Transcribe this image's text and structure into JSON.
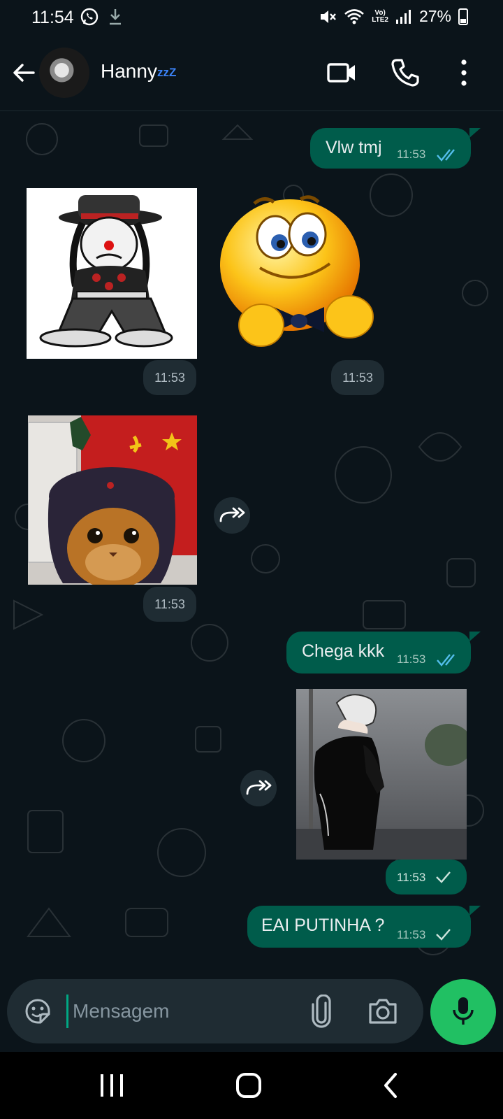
{
  "status_bar": {
    "time": "11:54",
    "volte_line1": "Vo)",
    "volte_line2": "LTE2",
    "battery": "27%"
  },
  "header": {
    "contact_name": "Hanny",
    "name_suffix": "zzZ"
  },
  "messages": {
    "m1": {
      "text": "Vlw tmj",
      "time": "11:53",
      "status": "read"
    },
    "sticker_clown": {
      "time": "11:53"
    },
    "sticker_emoji": {
      "time": "11:53"
    },
    "img_cat": {
      "time": "11:53"
    },
    "m2": {
      "text": "Chega kkk",
      "time": "11:53",
      "status": "read"
    },
    "img_anime": {
      "time": "11:53",
      "status": "delivered"
    },
    "m3": {
      "text": "EAI PUTINHA ?",
      "time": "11:53",
      "status": "delivered"
    }
  },
  "composer": {
    "placeholder": "Mensagem"
  },
  "colors": {
    "background": "#0b141a",
    "outgoing_bubble": "#005c4b",
    "read_tick": "#53bdeb",
    "accent_green": "#21c063"
  }
}
